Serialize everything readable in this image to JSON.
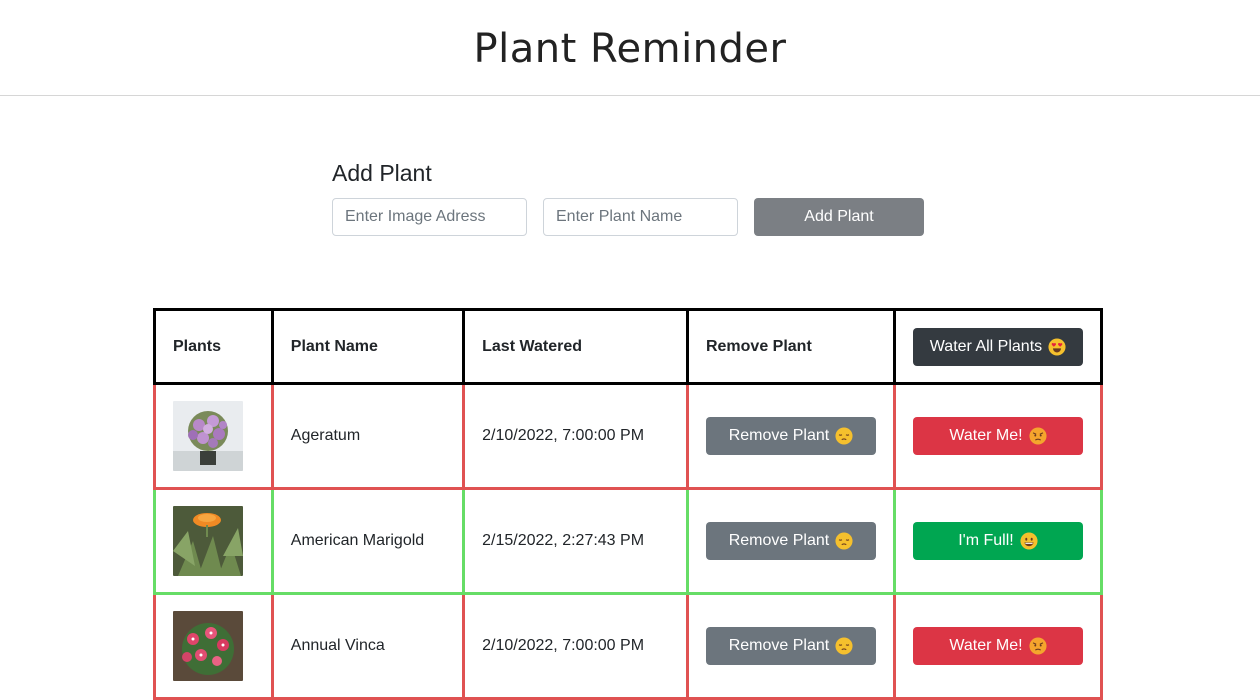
{
  "header": {
    "title": "Plant Reminder"
  },
  "add_plant": {
    "heading": "Add Plant",
    "image_placeholder": "Enter Image Adress",
    "name_placeholder": "Enter Plant Name",
    "button_label": "Add Plant"
  },
  "table": {
    "headers": {
      "plants": "Plants",
      "plant_name": "Plant Name",
      "last_watered": "Last Watered",
      "remove_plant": "Remove Plant",
      "water_all": "Water All Plants"
    },
    "rows": [
      {
        "name": "Ageratum",
        "last_watered": "2/10/2022, 7:00:00 PM",
        "remove_label": "Remove Plant",
        "status_label": "Water Me!",
        "status": "dry"
      },
      {
        "name": "American Marigold",
        "last_watered": "2/15/2022, 2:27:43 PM",
        "remove_label": "Remove Plant",
        "status_label": "I'm Full!",
        "status": "full"
      },
      {
        "name": "Annual Vinca",
        "last_watered": "2/10/2022, 7:00:00 PM",
        "remove_label": "Remove Plant",
        "status_label": "Water Me!",
        "status": "dry"
      }
    ]
  },
  "colors": {
    "dry_border": "#e05252",
    "full_border": "#66dd66",
    "water_me_button": "#dc3545",
    "full_button": "#00a651",
    "remove_button": "#6c757d",
    "water_all_button": "#343a40"
  }
}
